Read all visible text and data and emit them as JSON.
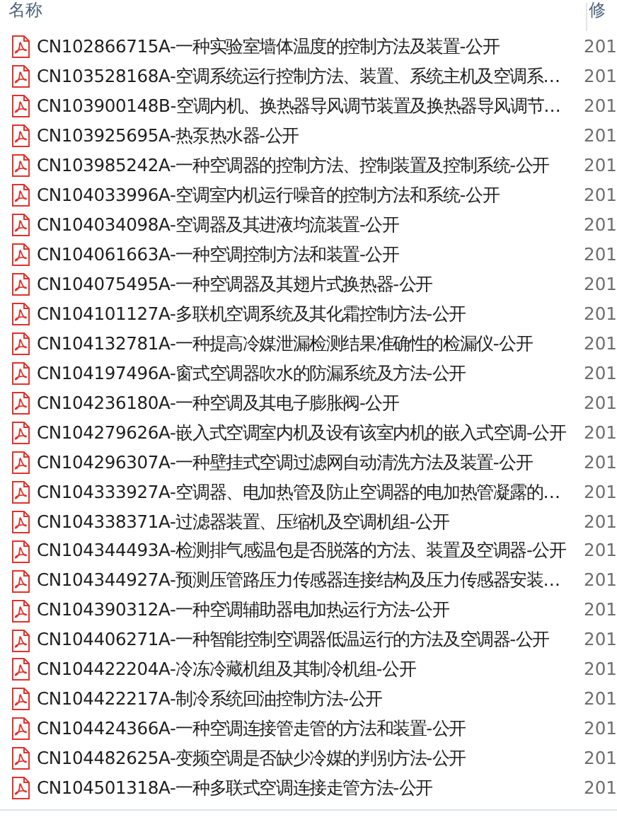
{
  "columns": [
    "名称",
    "修"
  ],
  "files": [
    {
      "name": "CN102866715A-一种实验室墙体温度的控制方法及装置-公开",
      "date": "201"
    },
    {
      "name": "CN103528168A-空调系统运行控制方法、装置、系统主机及空调系…",
      "date": "201"
    },
    {
      "name": "CN103900148B-空调内机、换热器导风调节装置及换热器导风调节…",
      "date": "201"
    },
    {
      "name": "CN103925695A-热泵热水器-公开",
      "date": "201"
    },
    {
      "name": "CN103985242A-一种空调器的控制方法、控制装置及控制系统-公开",
      "date": "201"
    },
    {
      "name": "CN104033996A-空调室内机运行噪音的控制方法和系统-公开",
      "date": "201"
    },
    {
      "name": "CN104034098A-空调器及其进液均流装置-公开",
      "date": "201"
    },
    {
      "name": "CN104061663A-一种空调控制方法和装置-公开",
      "date": "201"
    },
    {
      "name": "CN104075495A-一种空调器及其翅片式换热器-公开",
      "date": "201"
    },
    {
      "name": "CN104101127A-多联机空调系统及其化霜控制方法-公开",
      "date": "201"
    },
    {
      "name": "CN104132781A-一种提高冷媒泄漏检测结果准确性的检漏仪-公开",
      "date": "201"
    },
    {
      "name": "CN104197496A-窗式空调器吹水的防漏系统及方法-公开",
      "date": "201"
    },
    {
      "name": "CN104236180A-一种空调及其电子膨胀阀-公开",
      "date": "201"
    },
    {
      "name": "CN104279626A-嵌入式空调室内机及设有该室内机的嵌入式空调-公开",
      "date": "201"
    },
    {
      "name": "CN104296307A-一种壁挂式空调过滤网自动清洗方法及装置-公开",
      "date": "201"
    },
    {
      "name": "CN104333927A-空调器、电加热管及防止空调器的电加热管凝露的…",
      "date": "201"
    },
    {
      "name": "CN104338371A-过滤器装置、压缩机及空调机组-公开",
      "date": "201"
    },
    {
      "name": "CN104344493A-检测排气感温包是否脱落的方法、装置及空调器-公开",
      "date": "201"
    },
    {
      "name": "CN104344927A-预测压管路压力传感器连接结构及压力传感器安装…",
      "date": "201"
    },
    {
      "name": "CN104390312A-一种空调辅助器电加热运行方法-公开",
      "date": "201"
    },
    {
      "name": "CN104406271A-一种智能控制空调器低温运行的方法及空调器-公开",
      "date": "201"
    },
    {
      "name": "CN104422204A-冷冻冷藏机组及其制冷机组-公开",
      "date": "201"
    },
    {
      "name": "CN104422217A-制冷系统回油控制方法-公开",
      "date": "201"
    },
    {
      "name": "CN104424366A-一种空调连接管走管的方法和装置-公开",
      "date": "201"
    },
    {
      "name": "CN104482625A-变频空调是否缺少冷媒的判别方法-公开",
      "date": "201"
    },
    {
      "name": "CN104501318A-一种多联式空调连接走管方法-公开",
      "date": "201"
    }
  ]
}
